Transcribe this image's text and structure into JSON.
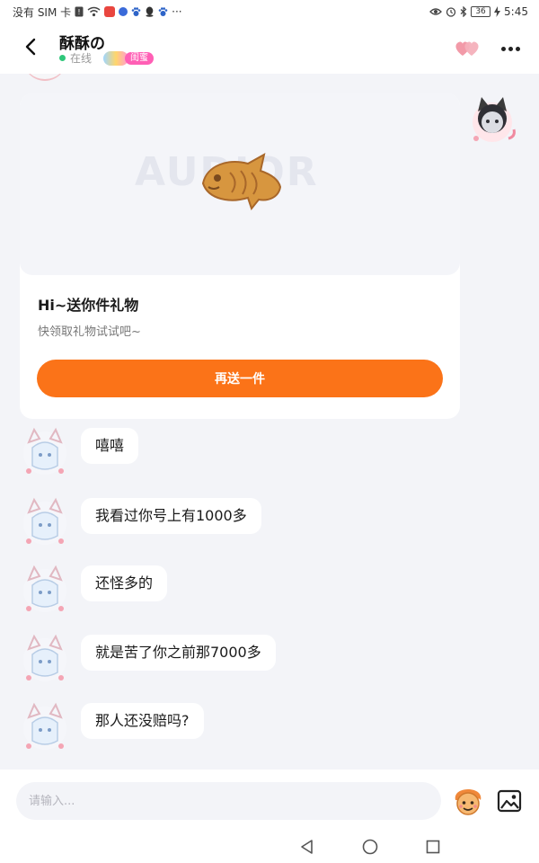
{
  "status_bar": {
    "carrier": "没有 SIM 卡",
    "overflow": "···",
    "battery": "36",
    "time": "5:45",
    "icons": [
      "sim-alert-icon",
      "wifi-icon",
      "app-badge-icon",
      "app-dot-icon",
      "paw-icon",
      "qq-icon",
      "paw-icon",
      "eye-icon",
      "alarm-icon",
      "bluetooth-icon",
      "battery-icon",
      "charging-icon"
    ]
  },
  "header": {
    "title": "酥酥の",
    "status": "在线",
    "pair_badge": "闺蜜",
    "icons": [
      "back-arrow-icon",
      "hearts-icon",
      "more-icon"
    ]
  },
  "gift": {
    "title": "Hi~送你件礼物",
    "subtitle": "快领取礼物试试吧~",
    "button": "再送一件",
    "watermark": "AUDIOR",
    "icon": "taiyaki-fish-icon"
  },
  "messages": [
    {
      "text": "嘻嘻"
    },
    {
      "text": "我看过你号上有1000多"
    },
    {
      "text": "还怪多的"
    },
    {
      "text": "就是苦了你之前那7000多"
    },
    {
      "text": "那人还没赔吗?"
    }
  ],
  "input": {
    "placeholder": "请输入...",
    "icons": [
      "emoji-icon",
      "image-icon"
    ]
  },
  "navigation": {
    "icons": [
      "nav-back-icon",
      "nav-home-icon",
      "nav-recents-icon"
    ]
  },
  "colors": {
    "accent": "#fb7318",
    "background": "#f3f4f8",
    "online": "#2fc77a",
    "badge": "#ff5fb5"
  }
}
